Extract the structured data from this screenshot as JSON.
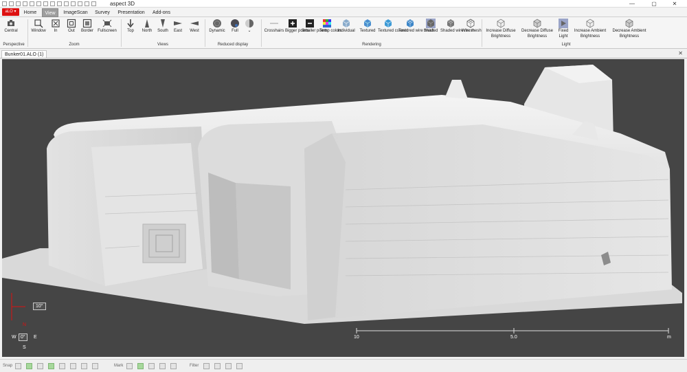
{
  "app": {
    "title": "aspect 3D",
    "file_button": "aLO ▾",
    "document_tab": "Bunker01.ALO (1)"
  },
  "window_controls": {
    "minimize": "—",
    "maximize": "▢",
    "close": "✕",
    "panel_close": "✕"
  },
  "tabs": [
    {
      "label": "Home",
      "active": false
    },
    {
      "label": "View",
      "active": true
    },
    {
      "label": "ImageScan",
      "active": false
    },
    {
      "label": "Survey",
      "active": false
    },
    {
      "label": "Presentation",
      "active": false
    },
    {
      "label": "Add-ons",
      "active": false
    }
  ],
  "ribbon": {
    "groups": [
      {
        "label": "Perspective",
        "buttons": [
          {
            "label": "Central",
            "icon": "central-camera-icon"
          }
        ]
      },
      {
        "label": "Zoom",
        "buttons": [
          {
            "label": "Window",
            "icon": "zoom-window-icon"
          },
          {
            "label": "In",
            "icon": "zoom-in-icon"
          },
          {
            "label": "Out",
            "icon": "zoom-out-icon"
          },
          {
            "label": "Border",
            "icon": "zoom-border-icon"
          },
          {
            "label": "Fullscreen",
            "icon": "fullscreen-icon"
          }
        ]
      },
      {
        "label": "Views",
        "buttons": [
          {
            "label": "Top",
            "icon": "arrow-down-icon"
          },
          {
            "label": "North",
            "icon": "north-cone-icon"
          },
          {
            "label": "South",
            "icon": "south-cone-icon"
          },
          {
            "label": "East",
            "icon": "east-cone-icon"
          },
          {
            "label": "West",
            "icon": "west-cone-icon"
          }
        ]
      },
      {
        "label": "Reduced display",
        "buttons": [
          {
            "label": "Dynamic",
            "icon": "dynamic-sphere-icon"
          },
          {
            "label": "Full",
            "icon": "full-sphere-icon"
          },
          {
            "label": "",
            "icon": "half-sphere-icon"
          }
        ]
      },
      {
        "label": "Rendering",
        "buttons": [
          {
            "label": "Crosshairs",
            "icon": "crosshairs-icon"
          },
          {
            "label": "Bigger points",
            "icon": "bigger-points-icon"
          },
          {
            "label": "Smaller points",
            "icon": "smaller-points-icon"
          },
          {
            "label": "Temp colors",
            "icon": "temp-colors-icon"
          },
          {
            "label": "Individual",
            "icon": "individual-icon"
          },
          {
            "label": "Textured",
            "icon": "textured-cube-icon"
          },
          {
            "label": "Textured colored",
            "icon": "textured-colored-cube-icon"
          },
          {
            "label": "Textured wire mesh",
            "icon": "textured-wire-mesh-icon"
          },
          {
            "label": "Shaded",
            "icon": "shaded-cube-icon"
          },
          {
            "label": "Shaded wire mesh",
            "icon": "shaded-wire-mesh-icon"
          },
          {
            "label": "Wire mesh",
            "icon": "wire-mesh-icon"
          }
        ]
      },
      {
        "label": "Light",
        "buttons": [
          {
            "label": "Increase Diffuse Brightness",
            "icon": "increase-diffuse-icon"
          },
          {
            "label": "Decrease Diffuse Brightness",
            "icon": "decrease-diffuse-icon"
          },
          {
            "label": "Fixed Light",
            "icon": "fixed-light-icon"
          },
          {
            "label": "Increase Ambient Brightness",
            "icon": "increase-ambient-icon"
          },
          {
            "label": "Decrease Ambient Brightness",
            "icon": "decrease-ambient-icon"
          }
        ]
      }
    ]
  },
  "viewport": {
    "background_color": "#454545",
    "model_name": "Bunker01",
    "tilt_readout": "10°",
    "compass": {
      "n": "N",
      "s": "S",
      "e": "E",
      "w": "W",
      "heading": "0°"
    },
    "scale": {
      "labels": [
        "10",
        "5.0",
        "m"
      ]
    }
  },
  "statusbar": {
    "snap": "Snap",
    "mark": "Mark",
    "filter": "Filter"
  },
  "colors": {
    "accent": "#d11111",
    "active_tab": "#9e9e9e",
    "viewport_bg": "#454545"
  }
}
